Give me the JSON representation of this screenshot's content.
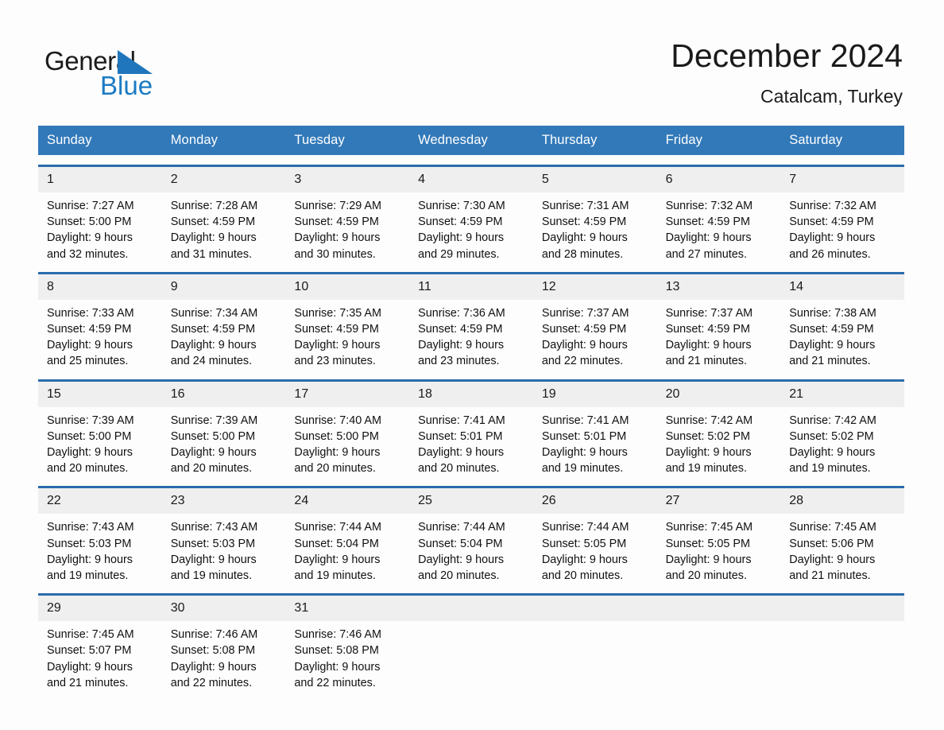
{
  "brand": {
    "name_part1": "General",
    "name_part2": "Blue",
    "triangle_icon": "triangle-icon",
    "accent_color": "#1f76bc"
  },
  "header": {
    "title": "December 2024",
    "subtitle": "Catalcam, Turkey"
  },
  "colors": {
    "header_blue": "#3279b9",
    "row_rule_blue": "#2b6cad",
    "day_number_band": "#efefef",
    "page_background": "#fdfdfd"
  },
  "weekday_headers": [
    "Sunday",
    "Monday",
    "Tuesday",
    "Wednesday",
    "Thursday",
    "Friday",
    "Saturday"
  ],
  "weeks": [
    [
      {
        "day": "1",
        "sunrise": "Sunrise: 7:27 AM",
        "sunset": "Sunset: 5:00 PM",
        "daylight_line1": "Daylight: 9 hours",
        "daylight_line2": "and 32 minutes."
      },
      {
        "day": "2",
        "sunrise": "Sunrise: 7:28 AM",
        "sunset": "Sunset: 4:59 PM",
        "daylight_line1": "Daylight: 9 hours",
        "daylight_line2": "and 31 minutes."
      },
      {
        "day": "3",
        "sunrise": "Sunrise: 7:29 AM",
        "sunset": "Sunset: 4:59 PM",
        "daylight_line1": "Daylight: 9 hours",
        "daylight_line2": "and 30 minutes."
      },
      {
        "day": "4",
        "sunrise": "Sunrise: 7:30 AM",
        "sunset": "Sunset: 4:59 PM",
        "daylight_line1": "Daylight: 9 hours",
        "daylight_line2": "and 29 minutes."
      },
      {
        "day": "5",
        "sunrise": "Sunrise: 7:31 AM",
        "sunset": "Sunset: 4:59 PM",
        "daylight_line1": "Daylight: 9 hours",
        "daylight_line2": "and 28 minutes."
      },
      {
        "day": "6",
        "sunrise": "Sunrise: 7:32 AM",
        "sunset": "Sunset: 4:59 PM",
        "daylight_line1": "Daylight: 9 hours",
        "daylight_line2": "and 27 minutes."
      },
      {
        "day": "7",
        "sunrise": "Sunrise: 7:32 AM",
        "sunset": "Sunset: 4:59 PM",
        "daylight_line1": "Daylight: 9 hours",
        "daylight_line2": "and 26 minutes."
      }
    ],
    [
      {
        "day": "8",
        "sunrise": "Sunrise: 7:33 AM",
        "sunset": "Sunset: 4:59 PM",
        "daylight_line1": "Daylight: 9 hours",
        "daylight_line2": "and 25 minutes."
      },
      {
        "day": "9",
        "sunrise": "Sunrise: 7:34 AM",
        "sunset": "Sunset: 4:59 PM",
        "daylight_line1": "Daylight: 9 hours",
        "daylight_line2": "and 24 minutes."
      },
      {
        "day": "10",
        "sunrise": "Sunrise: 7:35 AM",
        "sunset": "Sunset: 4:59 PM",
        "daylight_line1": "Daylight: 9 hours",
        "daylight_line2": "and 23 minutes."
      },
      {
        "day": "11",
        "sunrise": "Sunrise: 7:36 AM",
        "sunset": "Sunset: 4:59 PM",
        "daylight_line1": "Daylight: 9 hours",
        "daylight_line2": "and 23 minutes."
      },
      {
        "day": "12",
        "sunrise": "Sunrise: 7:37 AM",
        "sunset": "Sunset: 4:59 PM",
        "daylight_line1": "Daylight: 9 hours",
        "daylight_line2": "and 22 minutes."
      },
      {
        "day": "13",
        "sunrise": "Sunrise: 7:37 AM",
        "sunset": "Sunset: 4:59 PM",
        "daylight_line1": "Daylight: 9 hours",
        "daylight_line2": "and 21 minutes."
      },
      {
        "day": "14",
        "sunrise": "Sunrise: 7:38 AM",
        "sunset": "Sunset: 4:59 PM",
        "daylight_line1": "Daylight: 9 hours",
        "daylight_line2": "and 21 minutes."
      }
    ],
    [
      {
        "day": "15",
        "sunrise": "Sunrise: 7:39 AM",
        "sunset": "Sunset: 5:00 PM",
        "daylight_line1": "Daylight: 9 hours",
        "daylight_line2": "and 20 minutes."
      },
      {
        "day": "16",
        "sunrise": "Sunrise: 7:39 AM",
        "sunset": "Sunset: 5:00 PM",
        "daylight_line1": "Daylight: 9 hours",
        "daylight_line2": "and 20 minutes."
      },
      {
        "day": "17",
        "sunrise": "Sunrise: 7:40 AM",
        "sunset": "Sunset: 5:00 PM",
        "daylight_line1": "Daylight: 9 hours",
        "daylight_line2": "and 20 minutes."
      },
      {
        "day": "18",
        "sunrise": "Sunrise: 7:41 AM",
        "sunset": "Sunset: 5:01 PM",
        "daylight_line1": "Daylight: 9 hours",
        "daylight_line2": "and 20 minutes."
      },
      {
        "day": "19",
        "sunrise": "Sunrise: 7:41 AM",
        "sunset": "Sunset: 5:01 PM",
        "daylight_line1": "Daylight: 9 hours",
        "daylight_line2": "and 19 minutes."
      },
      {
        "day": "20",
        "sunrise": "Sunrise: 7:42 AM",
        "sunset": "Sunset: 5:02 PM",
        "daylight_line1": "Daylight: 9 hours",
        "daylight_line2": "and 19 minutes."
      },
      {
        "day": "21",
        "sunrise": "Sunrise: 7:42 AM",
        "sunset": "Sunset: 5:02 PM",
        "daylight_line1": "Daylight: 9 hours",
        "daylight_line2": "and 19 minutes."
      }
    ],
    [
      {
        "day": "22",
        "sunrise": "Sunrise: 7:43 AM",
        "sunset": "Sunset: 5:03 PM",
        "daylight_line1": "Daylight: 9 hours",
        "daylight_line2": "and 19 minutes."
      },
      {
        "day": "23",
        "sunrise": "Sunrise: 7:43 AM",
        "sunset": "Sunset: 5:03 PM",
        "daylight_line1": "Daylight: 9 hours",
        "daylight_line2": "and 19 minutes."
      },
      {
        "day": "24",
        "sunrise": "Sunrise: 7:44 AM",
        "sunset": "Sunset: 5:04 PM",
        "daylight_line1": "Daylight: 9 hours",
        "daylight_line2": "and 19 minutes."
      },
      {
        "day": "25",
        "sunrise": "Sunrise: 7:44 AM",
        "sunset": "Sunset: 5:04 PM",
        "daylight_line1": "Daylight: 9 hours",
        "daylight_line2": "and 20 minutes."
      },
      {
        "day": "26",
        "sunrise": "Sunrise: 7:44 AM",
        "sunset": "Sunset: 5:05 PM",
        "daylight_line1": "Daylight: 9 hours",
        "daylight_line2": "and 20 minutes."
      },
      {
        "day": "27",
        "sunrise": "Sunrise: 7:45 AM",
        "sunset": "Sunset: 5:05 PM",
        "daylight_line1": "Daylight: 9 hours",
        "daylight_line2": "and 20 minutes."
      },
      {
        "day": "28",
        "sunrise": "Sunrise: 7:45 AM",
        "sunset": "Sunset: 5:06 PM",
        "daylight_line1": "Daylight: 9 hours",
        "daylight_line2": "and 21 minutes."
      }
    ],
    [
      {
        "day": "29",
        "sunrise": "Sunrise: 7:45 AM",
        "sunset": "Sunset: 5:07 PM",
        "daylight_line1": "Daylight: 9 hours",
        "daylight_line2": "and 21 minutes."
      },
      {
        "day": "30",
        "sunrise": "Sunrise: 7:46 AM",
        "sunset": "Sunset: 5:08 PM",
        "daylight_line1": "Daylight: 9 hours",
        "daylight_line2": "and 22 minutes."
      },
      {
        "day": "31",
        "sunrise": "Sunrise: 7:46 AM",
        "sunset": "Sunset: 5:08 PM",
        "daylight_line1": "Daylight: 9 hours",
        "daylight_line2": "and 22 minutes."
      },
      {
        "day": "",
        "sunrise": "",
        "sunset": "",
        "daylight_line1": "",
        "daylight_line2": ""
      },
      {
        "day": "",
        "sunrise": "",
        "sunset": "",
        "daylight_line1": "",
        "daylight_line2": ""
      },
      {
        "day": "",
        "sunrise": "",
        "sunset": "",
        "daylight_line1": "",
        "daylight_line2": ""
      },
      {
        "day": "",
        "sunrise": "",
        "sunset": "",
        "daylight_line1": "",
        "daylight_line2": ""
      }
    ]
  ]
}
